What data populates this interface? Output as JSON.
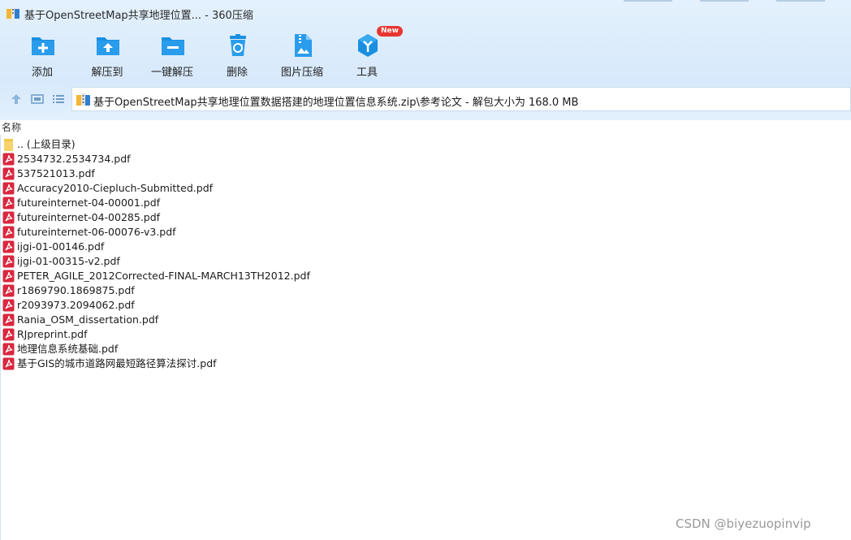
{
  "window": {
    "title": "基于OpenStreetMap共享地理位置... - 360压缩"
  },
  "toolbar": {
    "items": [
      {
        "label": "添加",
        "icon": "add-archive-icon"
      },
      {
        "label": "解压到",
        "icon": "extract-to-icon"
      },
      {
        "label": "一键解压",
        "icon": "one-click-extract-icon"
      },
      {
        "label": "删除",
        "icon": "delete-icon"
      },
      {
        "label": "图片压缩",
        "icon": "image-compress-icon"
      },
      {
        "label": "工具",
        "icon": "tools-icon",
        "badge": "New"
      }
    ]
  },
  "address": {
    "path": "基于OpenStreetMap共享地理位置数据搭建的地理位置信息系统.zip\\参考论文 - 解包大小为 168.0 MB"
  },
  "list": {
    "column_name": "名称",
    "items": [
      {
        "name": ".. (上级目录)",
        "type": "folder"
      },
      {
        "name": "2534732.2534734.pdf",
        "type": "pdf"
      },
      {
        "name": "537521013.pdf",
        "type": "pdf"
      },
      {
        "name": "Accuracy2010-Ciepluch-Submitted.pdf",
        "type": "pdf"
      },
      {
        "name": "futureinternet-04-00001.pdf",
        "type": "pdf"
      },
      {
        "name": "futureinternet-04-00285.pdf",
        "type": "pdf"
      },
      {
        "name": "futureinternet-06-00076-v3.pdf",
        "type": "pdf"
      },
      {
        "name": "ijgi-01-00146.pdf",
        "type": "pdf"
      },
      {
        "name": "ijgi-01-00315-v2.pdf",
        "type": "pdf"
      },
      {
        "name": "PETER_AGILE_2012Corrected-FINAL-MARCH13TH2012.pdf",
        "type": "pdf"
      },
      {
        "name": "r1869790.1869875.pdf",
        "type": "pdf"
      },
      {
        "name": "r2093973.2094062.pdf",
        "type": "pdf"
      },
      {
        "name": "Rania_OSM_dissertation.pdf",
        "type": "pdf"
      },
      {
        "name": "RJpreprint.pdf",
        "type": "pdf"
      },
      {
        "name": "地理信息系统基础.pdf",
        "type": "pdf"
      },
      {
        "name": "基于GIS的城市道路网最短路径算法探讨.pdf",
        "type": "pdf"
      }
    ]
  },
  "watermark": "CSDN @biyezuopinvip",
  "colors": {
    "accent_blue": "#1a8fe0",
    "pdf_red": "#d9283f",
    "folder_yellow": "#f6d36b",
    "badge_red": "#e8352f"
  }
}
